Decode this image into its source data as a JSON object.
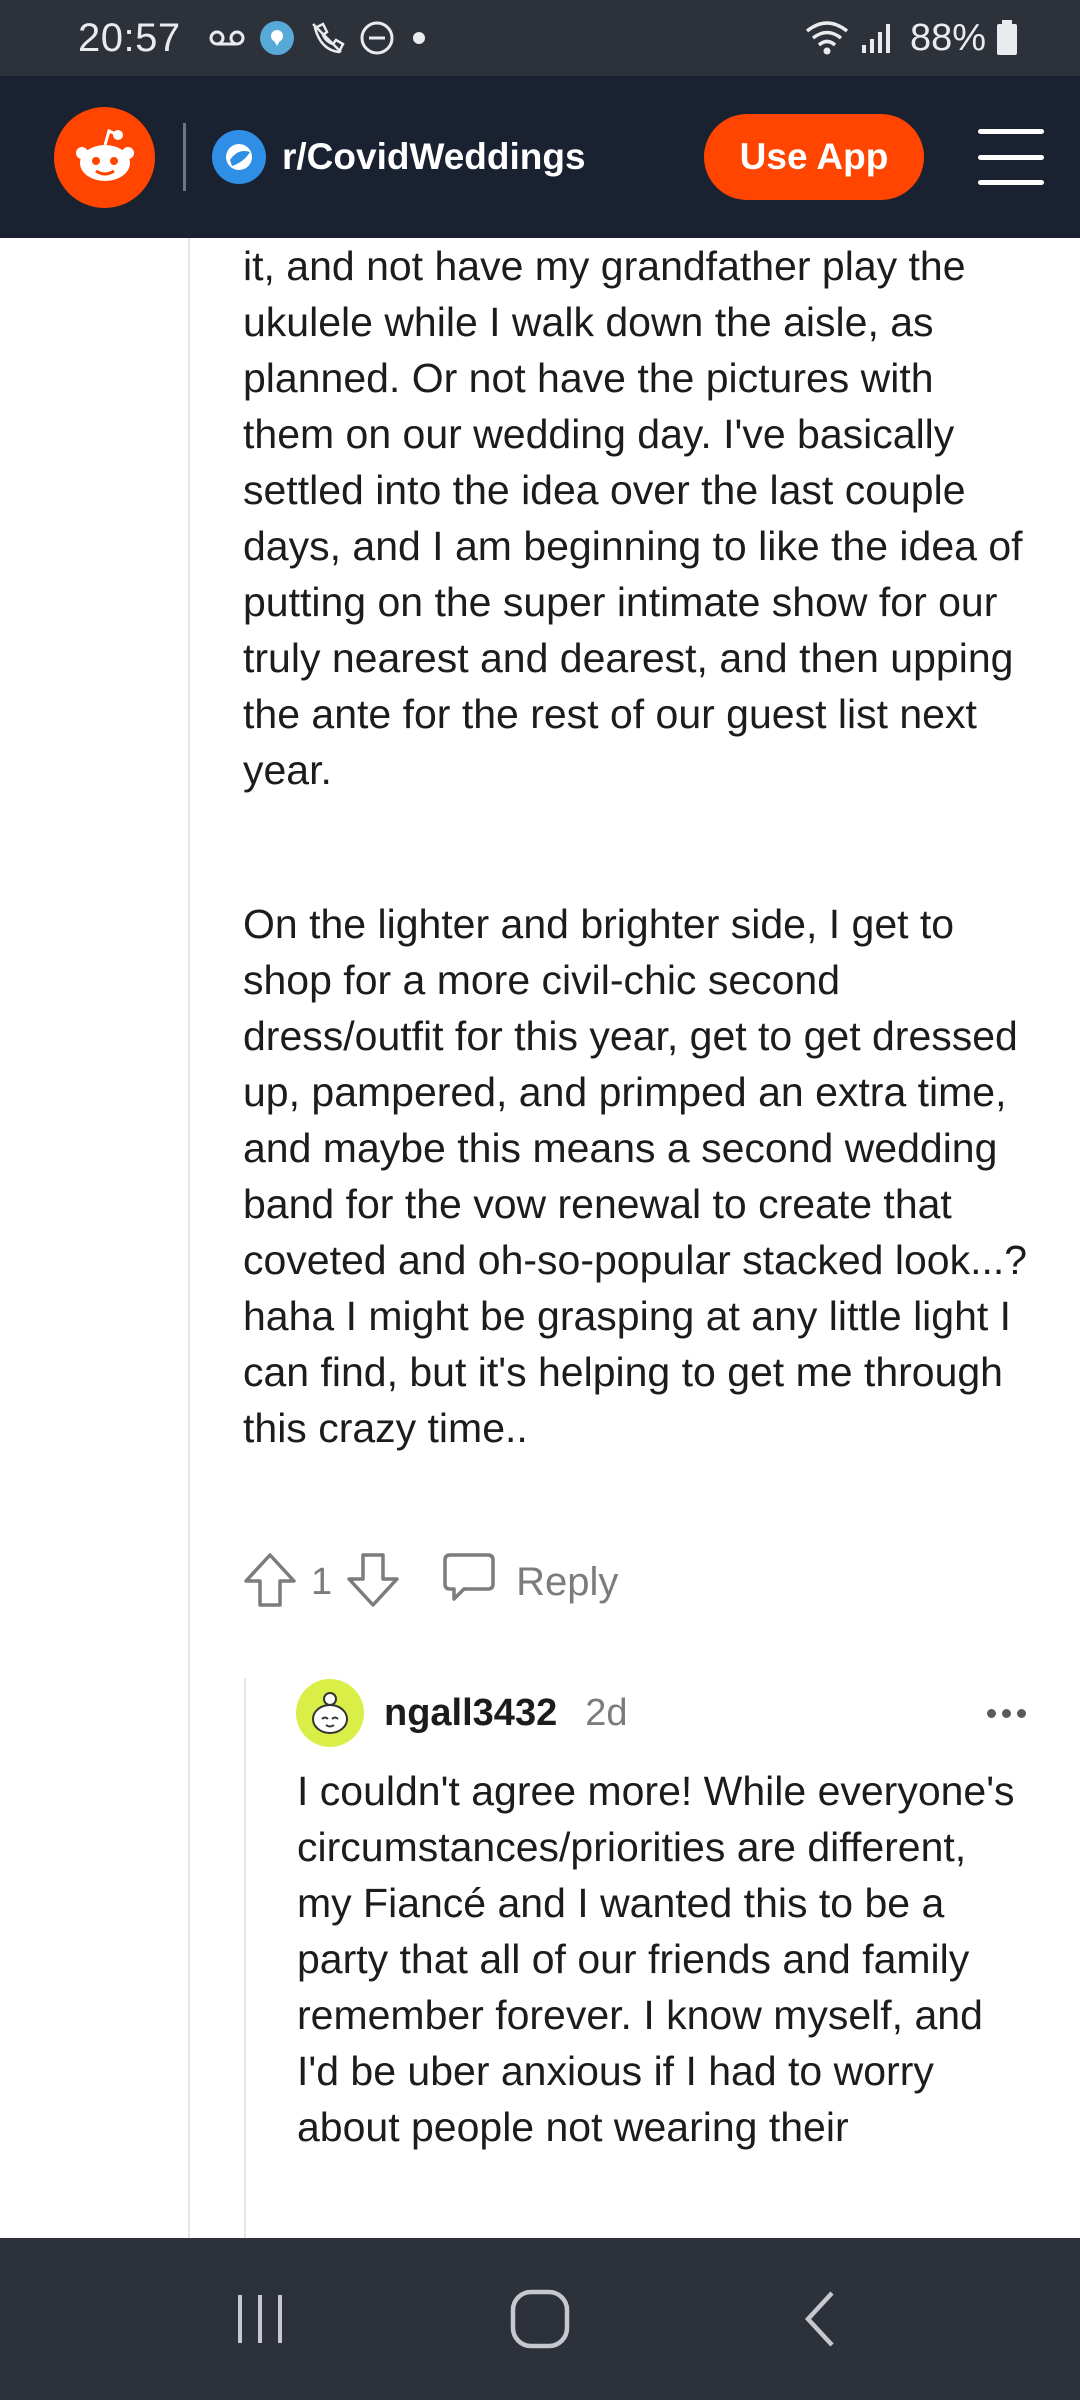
{
  "status_bar": {
    "time": "20:57",
    "battery": "88%"
  },
  "header": {
    "subreddit": "r/CovidWeddings",
    "use_app_label": "Use App",
    "accent": "#ff4500"
  },
  "parent_comment": {
    "paragraph_1": "it, and not have my grandfather play the ukulele while I walk down the aisle, as planned. Or not have the pictures with them on our wedding day. I've basically settled into the idea over the last couple days, and I am beginning to like the idea of putting on the super intimate show for our truly nearest and dearest, and then upping the ante for the rest of our guest list next year.",
    "paragraph_2": "On the lighter and brighter side, I get to shop for a more civil-chic second dress/outfit for this year, get to get dressed up, pampered, and primped an extra time, and maybe this means a second wedding band for the vow renewal to create that coveted and oh-so-popular stacked look...? haha I might be grasping at any little light I can find, but it's helping to get me through this crazy time..",
    "vote_count": "1",
    "reply_label": "Reply"
  },
  "child_comment": {
    "username": "ngall3432",
    "age": "2d",
    "body": "I couldn't agree more! While everyone's circumstances/priorities are different, my Fiancé and I wanted this to be a party that all of our friends and family remember forever. I know myself, and I'd be uber anxious if I had to worry about people not wearing their"
  }
}
